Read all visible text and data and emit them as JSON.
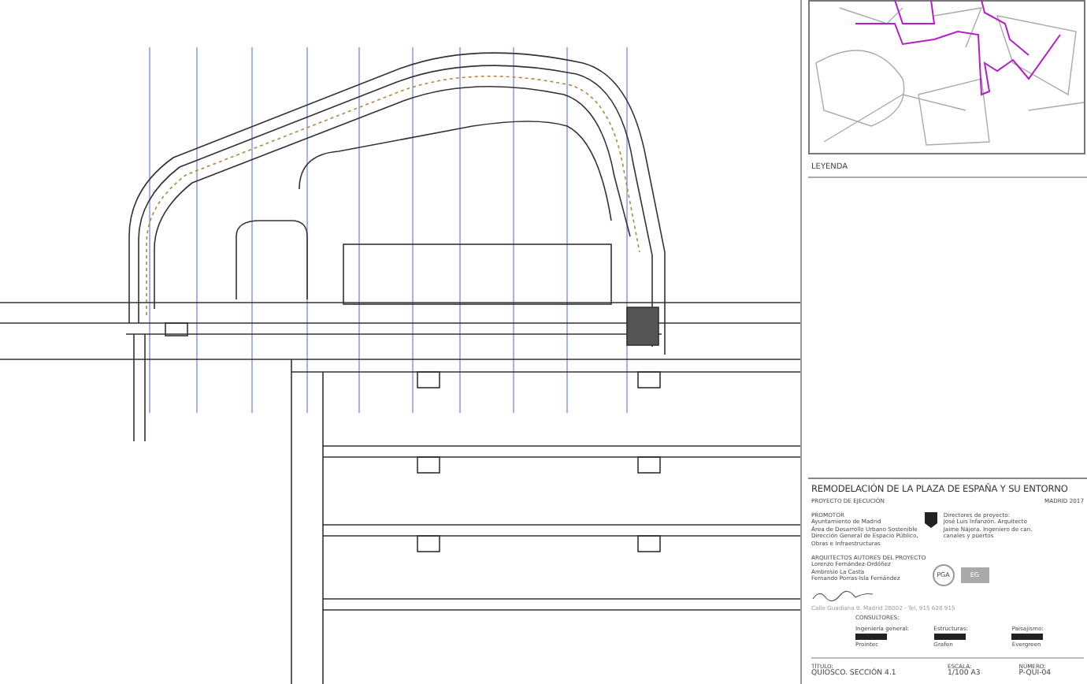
{
  "map": {
    "legend_title": "LEYENDA"
  },
  "title_block": {
    "project_title": "REMODELACIÓN DE LA PLAZA DE ESPAÑA Y SU ENTORNO",
    "phase": "PROYECTO DE EJECUCIÓN",
    "place_date": "MADRID 2017",
    "promoter_heading": "PROMOTOR",
    "promoter_lines": [
      "Ayuntamiento de Madrid",
      "Área de Desarrollo Urbano Sostenible",
      "Dirección General de Espacio Público,",
      "Obras e Infraestructuras"
    ],
    "directors_lines": [
      "Directores de proyecto:",
      "José Luis Infanzón. Arquitecto",
      "Jaime Nájera. Ingeniero de can.",
      "canales y puertos"
    ],
    "architects_heading": "ARQUITECTOS AUTORES DEL PROYECTO",
    "architects": [
      "Lorenzo Fernández-Ordóñez",
      "Ambrosio La Casta",
      "Fernando Porras-Isla Fernández"
    ],
    "logos": [
      "PGA",
      "EG"
    ],
    "address": "Calle Guadiana 9. Madrid 28002 · Tel. 915 628 915",
    "consultants_heading": "CONSULTORES:",
    "consultants": [
      {
        "role": "Ingeniería general:",
        "name": "Prointec"
      },
      {
        "role": "Estructuras:",
        "name": "Grafen"
      },
      {
        "role": "Paisajismo:",
        "name": "Evergreen"
      }
    ],
    "fields": [
      {
        "label": "TÍTULO:",
        "value": "QUIOSCO. SECCIÓN 4.1"
      },
      {
        "label": "ESCALA:",
        "value": "1/100 A3"
      },
      {
        "label": "NÚMERO:",
        "value": "P-QUI-04"
      }
    ]
  }
}
